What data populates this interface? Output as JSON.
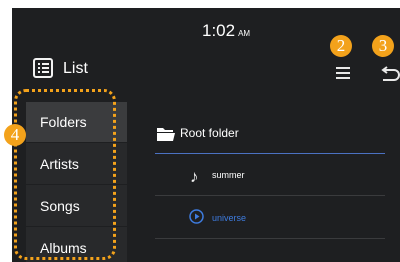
{
  "status_bar": {
    "time": "1:02",
    "ampm": "AM"
  },
  "header": {
    "title": "List",
    "icons": {
      "list": "list-icon",
      "menu": "menu-icon",
      "back": "back-icon"
    }
  },
  "annotations": {
    "marker_2": "2",
    "marker_3": "3",
    "marker_4": "4"
  },
  "sidebar": {
    "items": [
      {
        "label": "Folders",
        "active": true
      },
      {
        "label": "Artists",
        "active": false
      },
      {
        "label": "Songs",
        "active": false
      },
      {
        "label": "Albums",
        "active": false
      }
    ]
  },
  "content": {
    "root_folder": {
      "label": "Root folder",
      "icon": "folder-icon"
    },
    "songs": [
      {
        "title": "summer",
        "icon": "music-note-icon",
        "playing": false
      },
      {
        "title": "universe",
        "icon": "play-circle-icon",
        "playing": true
      }
    ]
  },
  "colors": {
    "background": "#1e1f21",
    "sidebar_bg": "#28292b",
    "active_bg": "#3b3c3e",
    "accent_blue": "#3e7ce0",
    "annotation_orange": "#f3a21b"
  }
}
